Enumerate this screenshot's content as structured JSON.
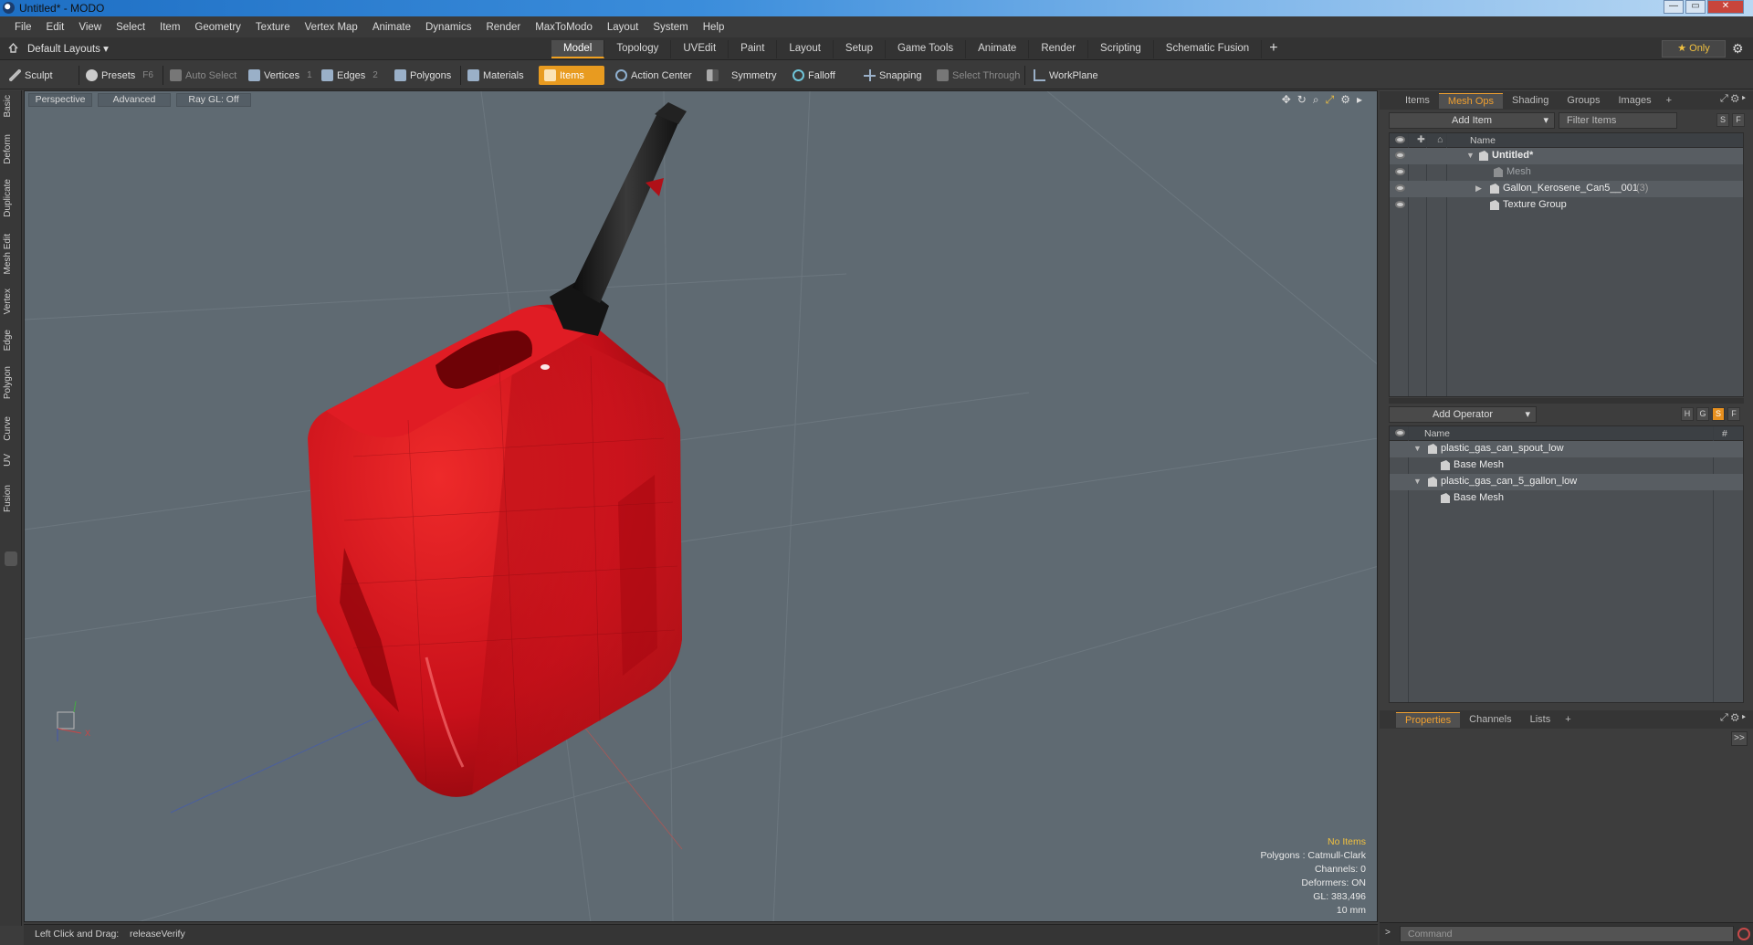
{
  "window": {
    "title": "Untitled* - MODO"
  },
  "menu": [
    "File",
    "Edit",
    "View",
    "Select",
    "Item",
    "Geometry",
    "Texture",
    "Vertex Map",
    "Animate",
    "Dynamics",
    "Render",
    "MaxToModo",
    "Layout",
    "System",
    "Help"
  ],
  "layout": {
    "selector": "Default Layouts ▾",
    "tabs": [
      "Model",
      "Topology",
      "UVEdit",
      "Paint",
      "Layout",
      "Setup",
      "Game Tools",
      "Animate",
      "Render",
      "Scripting",
      "Schematic Fusion"
    ],
    "active_tab": "Model",
    "only_label": "★  Only"
  },
  "toolbar": {
    "sculpt": "Sculpt",
    "presets": "Presets",
    "presets_key": "F6",
    "auto_select": "Auto Select",
    "vertices": "Vertices",
    "vertices_key": "1",
    "edges": "Edges",
    "edges_key": "2",
    "polygons": "Polygons",
    "materials": "Materials",
    "items": "Items",
    "action_center": "Action Center",
    "symmetry": "Symmetry",
    "falloff": "Falloff",
    "snapping": "Snapping",
    "select_through": "Select Through",
    "workplane": "WorkPlane"
  },
  "left_tabs": [
    "Basic",
    "Deform",
    "Duplicate",
    "Mesh Edit",
    "Vertex",
    "Edge",
    "Polygon",
    "Curve",
    "UV",
    "Fusion"
  ],
  "viewport": {
    "perspective": "Perspective",
    "advanced": "Advanced",
    "raygl": "Ray GL: Off",
    "info": {
      "no_items": "No Items",
      "polygons": "Polygons : Catmull-Clark",
      "channels": "Channels: 0",
      "deformers": "Deformers: ON",
      "gl": "GL: 383,496",
      "unit": "10 mm"
    }
  },
  "status": {
    "text": "Left Click and Drag:",
    "action": "releaseVerify"
  },
  "items_panel": {
    "tabs": [
      "Items",
      "Mesh Ops",
      "Shading",
      "Groups",
      "Images"
    ],
    "active_tab": "Mesh Ops",
    "add_item": "Add Item",
    "filter": "Filter Items",
    "btn_s": "S",
    "btn_f": "F",
    "col_name": "Name",
    "rows": [
      {
        "label": "Untitled*"
      },
      {
        "label": "Mesh"
      },
      {
        "label": "Gallon_Kerosene_Can5__001",
        "count": "(3)"
      },
      {
        "label": "Texture Group"
      }
    ]
  },
  "operators_panel": {
    "add_operator": "Add Operator",
    "btn_h": "H",
    "btn_g": "G",
    "btn_s": "S",
    "btn_f": "F",
    "col_name": "Name",
    "col_hash": "#",
    "rows": [
      {
        "label": "plastic_gas_can_spout_low"
      },
      {
        "label": "Base Mesh"
      },
      {
        "label": "plastic_gas_can_5_gallon_low"
      },
      {
        "label": "Base Mesh"
      }
    ]
  },
  "props_panel": {
    "tabs": [
      "Properties",
      "Channels",
      "Lists"
    ],
    "active_tab": "Properties",
    "expand": ">>"
  },
  "command": {
    "placeholder": "Command"
  },
  "colors": {
    "accent": "#e89b20",
    "viewport_bg": "#5f6a72",
    "can_red": "#d4101a"
  }
}
